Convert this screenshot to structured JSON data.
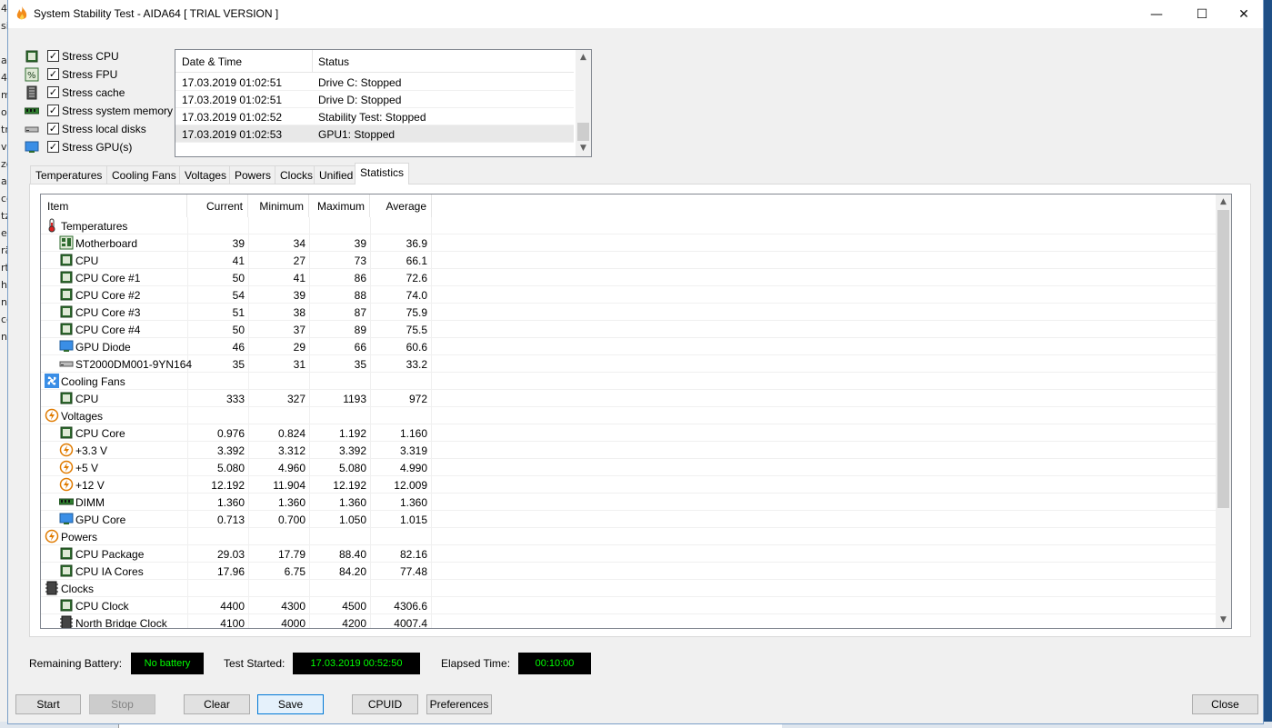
{
  "window": {
    "title": "System Stability Test - AIDA64  [ TRIAL VERSION ]",
    "controls": {
      "minimize": "—",
      "maximize": "☐",
      "close": "✕"
    }
  },
  "backdrop": {
    "left_chars": [
      "4",
      "si",
      "",
      "av",
      "4",
      "m",
      "ot",
      "tri",
      "vi",
      "ze",
      "alt",
      "ce",
      "tz",
      "ec",
      "rä",
      "rt",
      "he",
      "nf",
      "ce",
      "nc"
    ]
  },
  "stress_options": [
    {
      "label": "Stress CPU",
      "checked": true,
      "icon": "cpu-chip-icon"
    },
    {
      "label": "Stress FPU",
      "checked": true,
      "icon": "fpu-icon"
    },
    {
      "label": "Stress cache",
      "checked": true,
      "icon": "cache-icon"
    },
    {
      "label": "Stress system memory",
      "checked": true,
      "icon": "memory-icon"
    },
    {
      "label": "Stress local disks",
      "checked": true,
      "icon": "disk-icon"
    },
    {
      "label": "Stress GPU(s)",
      "checked": true,
      "icon": "gpu-icon"
    }
  ],
  "log": {
    "headers": {
      "datetime": "Date & Time",
      "status": "Status"
    },
    "rows": [
      {
        "datetime": "17.03.2019 01:02:51",
        "status": "Drive C: Stopped"
      },
      {
        "datetime": "17.03.2019 01:02:51",
        "status": "Drive D: Stopped"
      },
      {
        "datetime": "17.03.2019 01:02:52",
        "status": "Stability Test: Stopped"
      },
      {
        "datetime": "17.03.2019 01:02:53",
        "status": "GPU1: Stopped"
      }
    ]
  },
  "tabs": [
    "Temperatures",
    "Cooling Fans",
    "Voltages",
    "Powers",
    "Clocks",
    "Unified",
    "Statistics"
  ],
  "active_tab": "Statistics",
  "stats": {
    "headers": {
      "item": "Item",
      "current": "Current",
      "minimum": "Minimum",
      "maximum": "Maximum",
      "average": "Average"
    },
    "rows": [
      {
        "type": "group",
        "name": "Temperatures",
        "icon": "thermometer-icon"
      },
      {
        "type": "item",
        "name": "Motherboard",
        "icon": "motherboard-icon",
        "cur": "39",
        "min": "34",
        "max": "39",
        "avg": "36.9"
      },
      {
        "type": "item",
        "name": "CPU",
        "icon": "cpu-chip-icon",
        "cur": "41",
        "min": "27",
        "max": "73",
        "avg": "66.1"
      },
      {
        "type": "item",
        "name": "CPU Core #1",
        "icon": "cpu-chip-icon",
        "cur": "50",
        "min": "41",
        "max": "86",
        "avg": "72.6"
      },
      {
        "type": "item",
        "name": "CPU Core #2",
        "icon": "cpu-chip-icon",
        "cur": "54",
        "min": "39",
        "max": "88",
        "avg": "74.0"
      },
      {
        "type": "item",
        "name": "CPU Core #3",
        "icon": "cpu-chip-icon",
        "cur": "51",
        "min": "38",
        "max": "87",
        "avg": "75.9"
      },
      {
        "type": "item",
        "name": "CPU Core #4",
        "icon": "cpu-chip-icon",
        "cur": "50",
        "min": "37",
        "max": "89",
        "avg": "75.5"
      },
      {
        "type": "item",
        "name": "GPU Diode",
        "icon": "gpu-icon",
        "cur": "46",
        "min": "29",
        "max": "66",
        "avg": "60.6"
      },
      {
        "type": "item",
        "name": "ST2000DM001-9YN164",
        "icon": "disk-icon",
        "cur": "35",
        "min": "31",
        "max": "35",
        "avg": "33.2"
      },
      {
        "type": "group",
        "name": "Cooling Fans",
        "icon": "fan-icon"
      },
      {
        "type": "item",
        "name": "CPU",
        "icon": "cpu-chip-icon",
        "cur": "333",
        "min": "327",
        "max": "1193",
        "avg": "972"
      },
      {
        "type": "group",
        "name": "Voltages",
        "icon": "voltage-icon"
      },
      {
        "type": "item",
        "name": "CPU Core",
        "icon": "cpu-chip-icon",
        "cur": "0.976",
        "min": "0.824",
        "max": "1.192",
        "avg": "1.160"
      },
      {
        "type": "item",
        "name": "+3.3 V",
        "icon": "voltage-icon",
        "cur": "3.392",
        "min": "3.312",
        "max": "3.392",
        "avg": "3.319"
      },
      {
        "type": "item",
        "name": "+5 V",
        "icon": "voltage-icon",
        "cur": "5.080",
        "min": "4.960",
        "max": "5.080",
        "avg": "4.990"
      },
      {
        "type": "item",
        "name": "+12 V",
        "icon": "voltage-icon",
        "cur": "12.192",
        "min": "11.904",
        "max": "12.192",
        "avg": "12.009"
      },
      {
        "type": "item",
        "name": "DIMM",
        "icon": "memory-icon",
        "cur": "1.360",
        "min": "1.360",
        "max": "1.360",
        "avg": "1.360"
      },
      {
        "type": "item",
        "name": "GPU Core",
        "icon": "gpu-icon",
        "cur": "0.713",
        "min": "0.700",
        "max": "1.050",
        "avg": "1.015"
      },
      {
        "type": "group",
        "name": "Powers",
        "icon": "voltage-icon"
      },
      {
        "type": "item",
        "name": "CPU Package",
        "icon": "cpu-chip-icon",
        "cur": "29.03",
        "min": "17.79",
        "max": "88.40",
        "avg": "82.16"
      },
      {
        "type": "item",
        "name": "CPU IA Cores",
        "icon": "cpu-chip-icon",
        "cur": "17.96",
        "min": "6.75",
        "max": "84.20",
        "avg": "77.48"
      },
      {
        "type": "group",
        "name": "Clocks",
        "icon": "clock-chip-icon"
      },
      {
        "type": "item",
        "name": "CPU Clock",
        "icon": "cpu-chip-icon",
        "cur": "4400",
        "min": "4300",
        "max": "4500",
        "avg": "4306.6"
      },
      {
        "type": "item",
        "name": "North Bridge Clock",
        "icon": "clock-chip-icon",
        "cur": "4100",
        "min": "4000",
        "max": "4200",
        "avg": "4007.4"
      }
    ]
  },
  "status": {
    "battery_label": "Remaining Battery:",
    "battery_value": "No battery",
    "started_label": "Test Started:",
    "started_value": "17.03.2019 00:52:50",
    "elapsed_label": "Elapsed Time:",
    "elapsed_value": "00:10:00"
  },
  "buttons": {
    "start": "Start",
    "stop": "Stop",
    "clear": "Clear",
    "save": "Save",
    "cpuid": "CPUID",
    "preferences": "Preferences",
    "close": "Close"
  },
  "colors": {
    "display_bg": "#000000",
    "display_fg": "#00ff00",
    "accent": "#0078d7"
  }
}
